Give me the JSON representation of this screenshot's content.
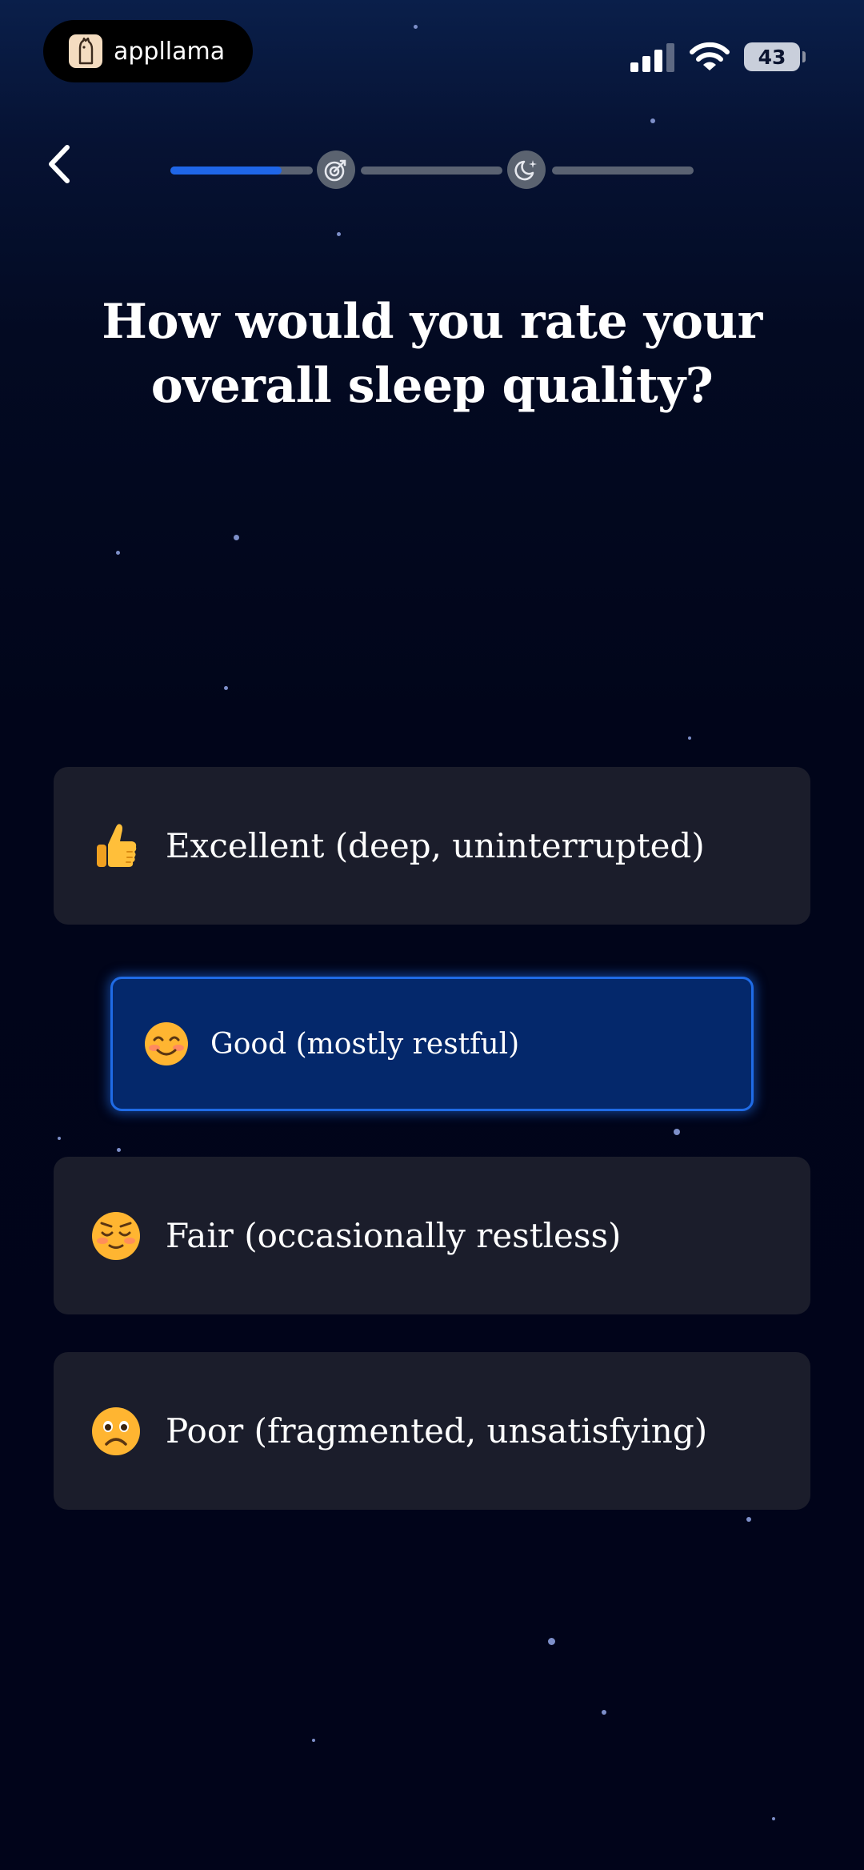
{
  "status_bar": {
    "app_name": "appllama",
    "battery": "43"
  },
  "nav": {
    "progress_fraction": 0.78,
    "step_icons": [
      "target-icon",
      "moon-sparkle-icon"
    ]
  },
  "question": {
    "title": "How would you rate your overall sleep quality?"
  },
  "options": [
    {
      "label": "Excellent (deep, uninterrupted)",
      "icon": "thumbs-up-icon",
      "selected": false
    },
    {
      "label": "Good (mostly restful)",
      "icon": "smiling-face-icon",
      "selected": true
    },
    {
      "label": "Fair (occasionally restless)",
      "icon": "relieved-face-icon",
      "selected": false
    },
    {
      "label": "Poor (fragmented, unsatisfying)",
      "icon": "frowning-face-icon",
      "selected": false
    }
  ],
  "colors": {
    "accent": "#1f66e8",
    "selected_bg": "#04286b",
    "option_bg": "#1b1d2b"
  }
}
